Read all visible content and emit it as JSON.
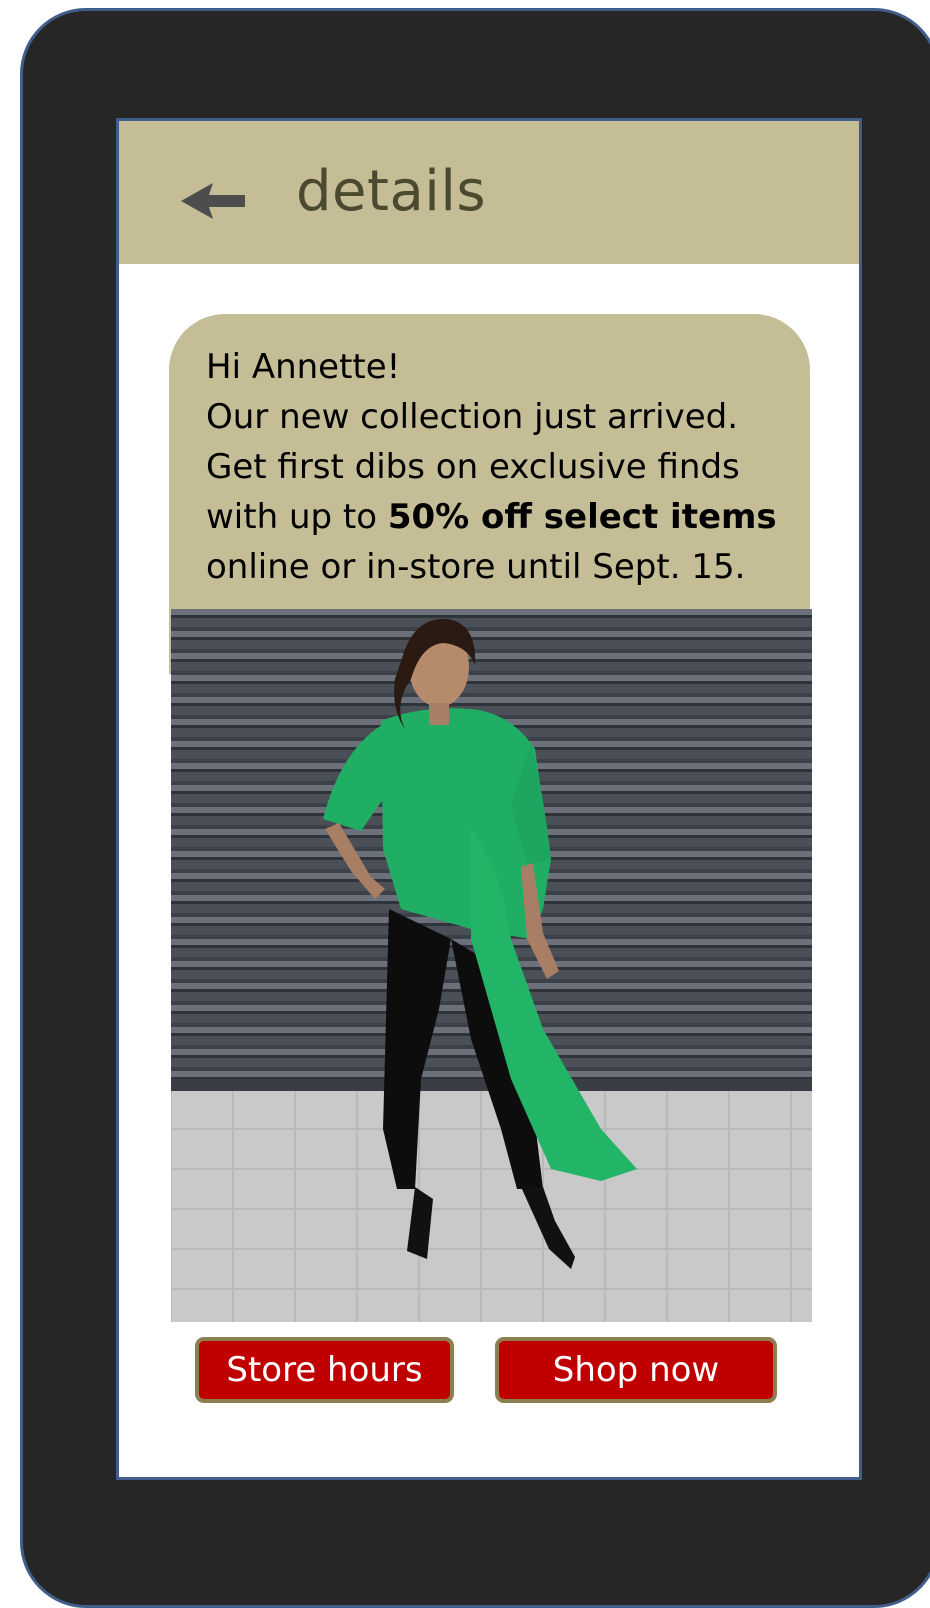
{
  "header": {
    "title": "details",
    "back_icon": "arrow-left-icon"
  },
  "message": {
    "greeting": "Hi Annette!",
    "line1": "Our new collection just arrived.",
    "line2": "Get first dibs on exclusive finds",
    "line3_prefix": "with up to ",
    "line3_bold": "50% off select items",
    "line4": "online or in-store until  Sept. 15."
  },
  "actions": {
    "store_hours_label": "Store hours",
    "shop_now_label": "Shop now"
  },
  "colors": {
    "frame": "#262626",
    "accent_tan": "#c4bd96",
    "button_red": "#c00000",
    "button_border": "#8c7f4f",
    "outline_blue": "#3f5f8a"
  }
}
